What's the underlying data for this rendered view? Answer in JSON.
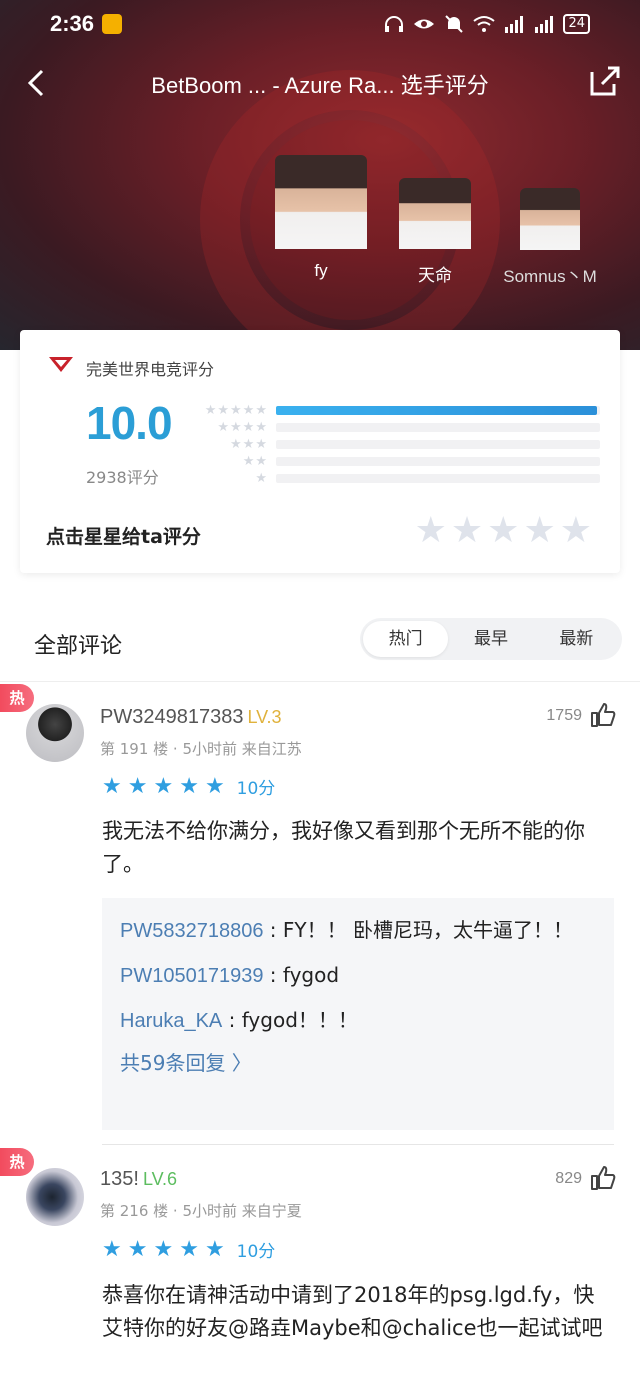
{
  "status": {
    "time": "2:36",
    "battery": "24"
  },
  "nav": {
    "title": "BetBoom ... - Azure Ra... 选手评分"
  },
  "players": [
    {
      "name": "fy"
    },
    {
      "name": "天命"
    },
    {
      "name": "Somnus丶M"
    }
  ],
  "rating": {
    "brand": "完美世界电竞评分",
    "score": "10.0",
    "count": "2938评分",
    "distribution": [
      {
        "stars": "★★★★★",
        "fraction": 0.99
      },
      {
        "stars": "★★★★",
        "fraction": 0.0
      },
      {
        "stars": "★★★",
        "fraction": 0.0
      },
      {
        "stars": "★★",
        "fraction": 0.0
      },
      {
        "stars": "★",
        "fraction": 0.0
      }
    ],
    "prompt": "点击星星给ta评分"
  },
  "comments_header": {
    "title": "全部评论",
    "tabs": [
      "热门",
      "最早",
      "最新"
    ],
    "active_tab": "热门"
  },
  "comments": [
    {
      "badge": "热",
      "user": "PW3249817383",
      "level": "LV.3",
      "meta": "第 191 楼 · 5小时前  来自江苏",
      "likes": "1759",
      "score": "10分",
      "text": "我无法不给你满分，我好像又看到那个无所不能的你了。",
      "replies": [
        {
          "user": "PW5832718806",
          "text": " : FY！！ 卧槽尼玛，太牛逼了！！"
        },
        {
          "user": "PW1050171939",
          "text": " : fygod"
        },
        {
          "user": "Haruka_KA",
          "text": " : fygod！！！"
        }
      ],
      "more_replies": "共59条回复  〉"
    },
    {
      "badge": "热",
      "user": "135!",
      "level": "LV.6",
      "meta": "第 216 楼 · 5小时前  来自宁夏",
      "likes": "829",
      "score": "10分",
      "text": "恭喜你在请神活动中请到了2018年的psg.lgd.fy，快艾特你的好友@路垚Maybe和@chalice也一起试试吧"
    }
  ],
  "colors": {
    "accent": "#2b9ed6",
    "hot": "#f24b5e",
    "reply_user": "#4c7eb3"
  }
}
